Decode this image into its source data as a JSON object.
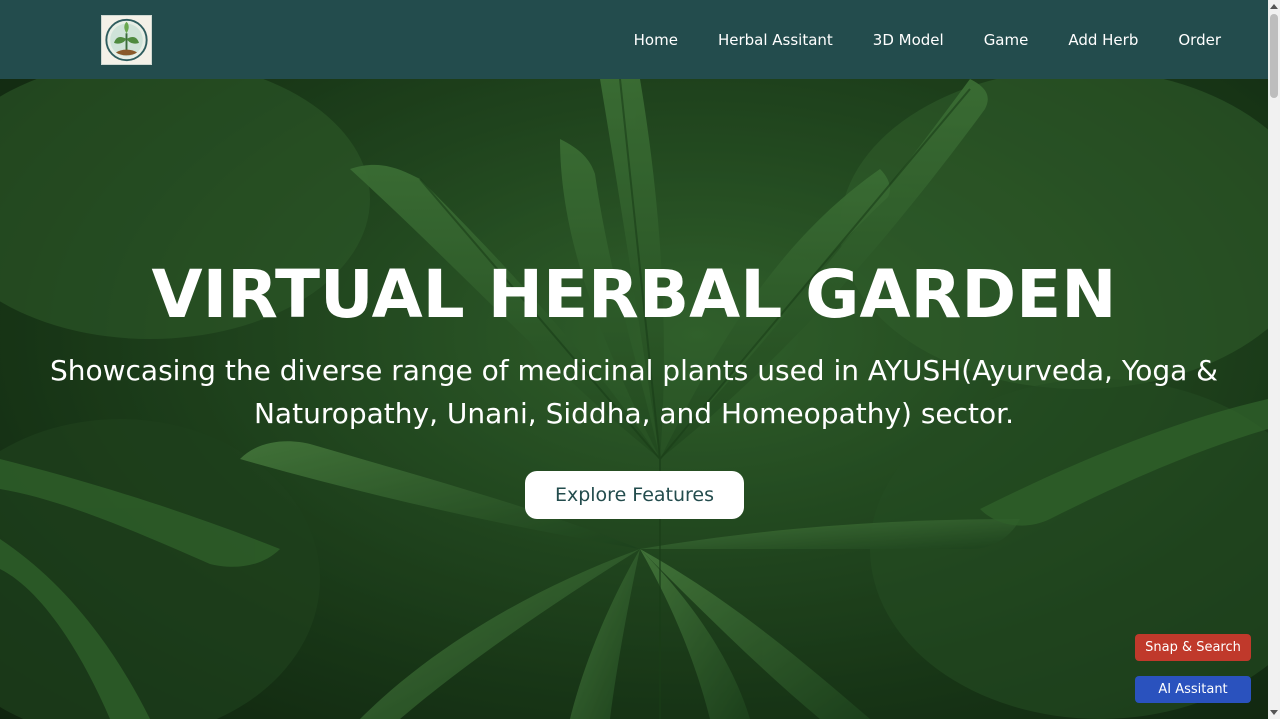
{
  "nav": {
    "logo_icon": "herbal-garden-logo",
    "links": [
      "Home",
      "Herbal Assitant",
      "3D Model",
      "Game",
      "Add Herb",
      "Order"
    ]
  },
  "hero": {
    "background_icon": "herb-leaves-photo",
    "title": "VIRTUAL HERBAL GARDEN",
    "subtitle_line1": "Showcasing the diverse range of medicinal plants used in AYUSH(Ayurveda, Yoga &",
    "subtitle_line2": "Naturopathy, Unani, Siddha, and Homeopathy) sector.",
    "cta_label": "Explore Features"
  },
  "floating": {
    "snap_label": "Snap & Search",
    "ai_label": "AI Assitant",
    "snap_color": "#c0392b",
    "ai_color": "#2a52be"
  },
  "colors": {
    "navbar": "#234c4d",
    "cta_text": "#234c4d"
  }
}
